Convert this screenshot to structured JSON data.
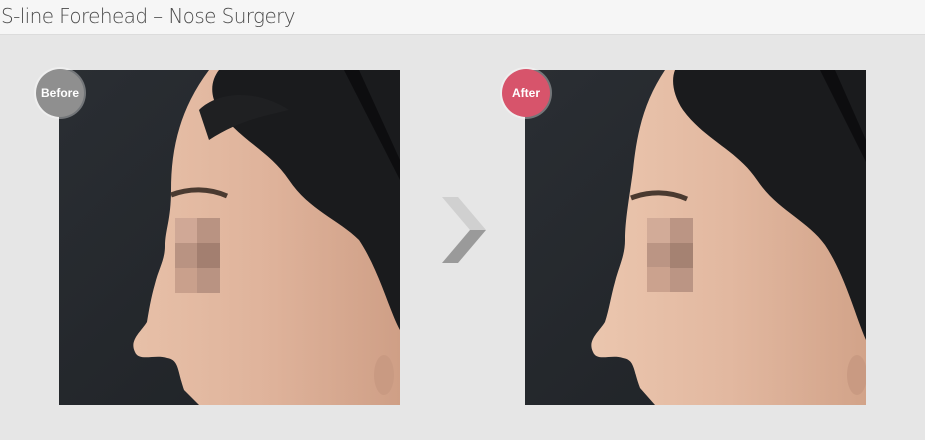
{
  "header": {
    "title": "S-line Forehead – Nose Surgery"
  },
  "badges": {
    "before_label": "Before",
    "after_label": "After",
    "before_color": "#8f8f8f",
    "after_color": "#d7546b"
  },
  "icons": {
    "arrow": "chevron-right-icon"
  }
}
